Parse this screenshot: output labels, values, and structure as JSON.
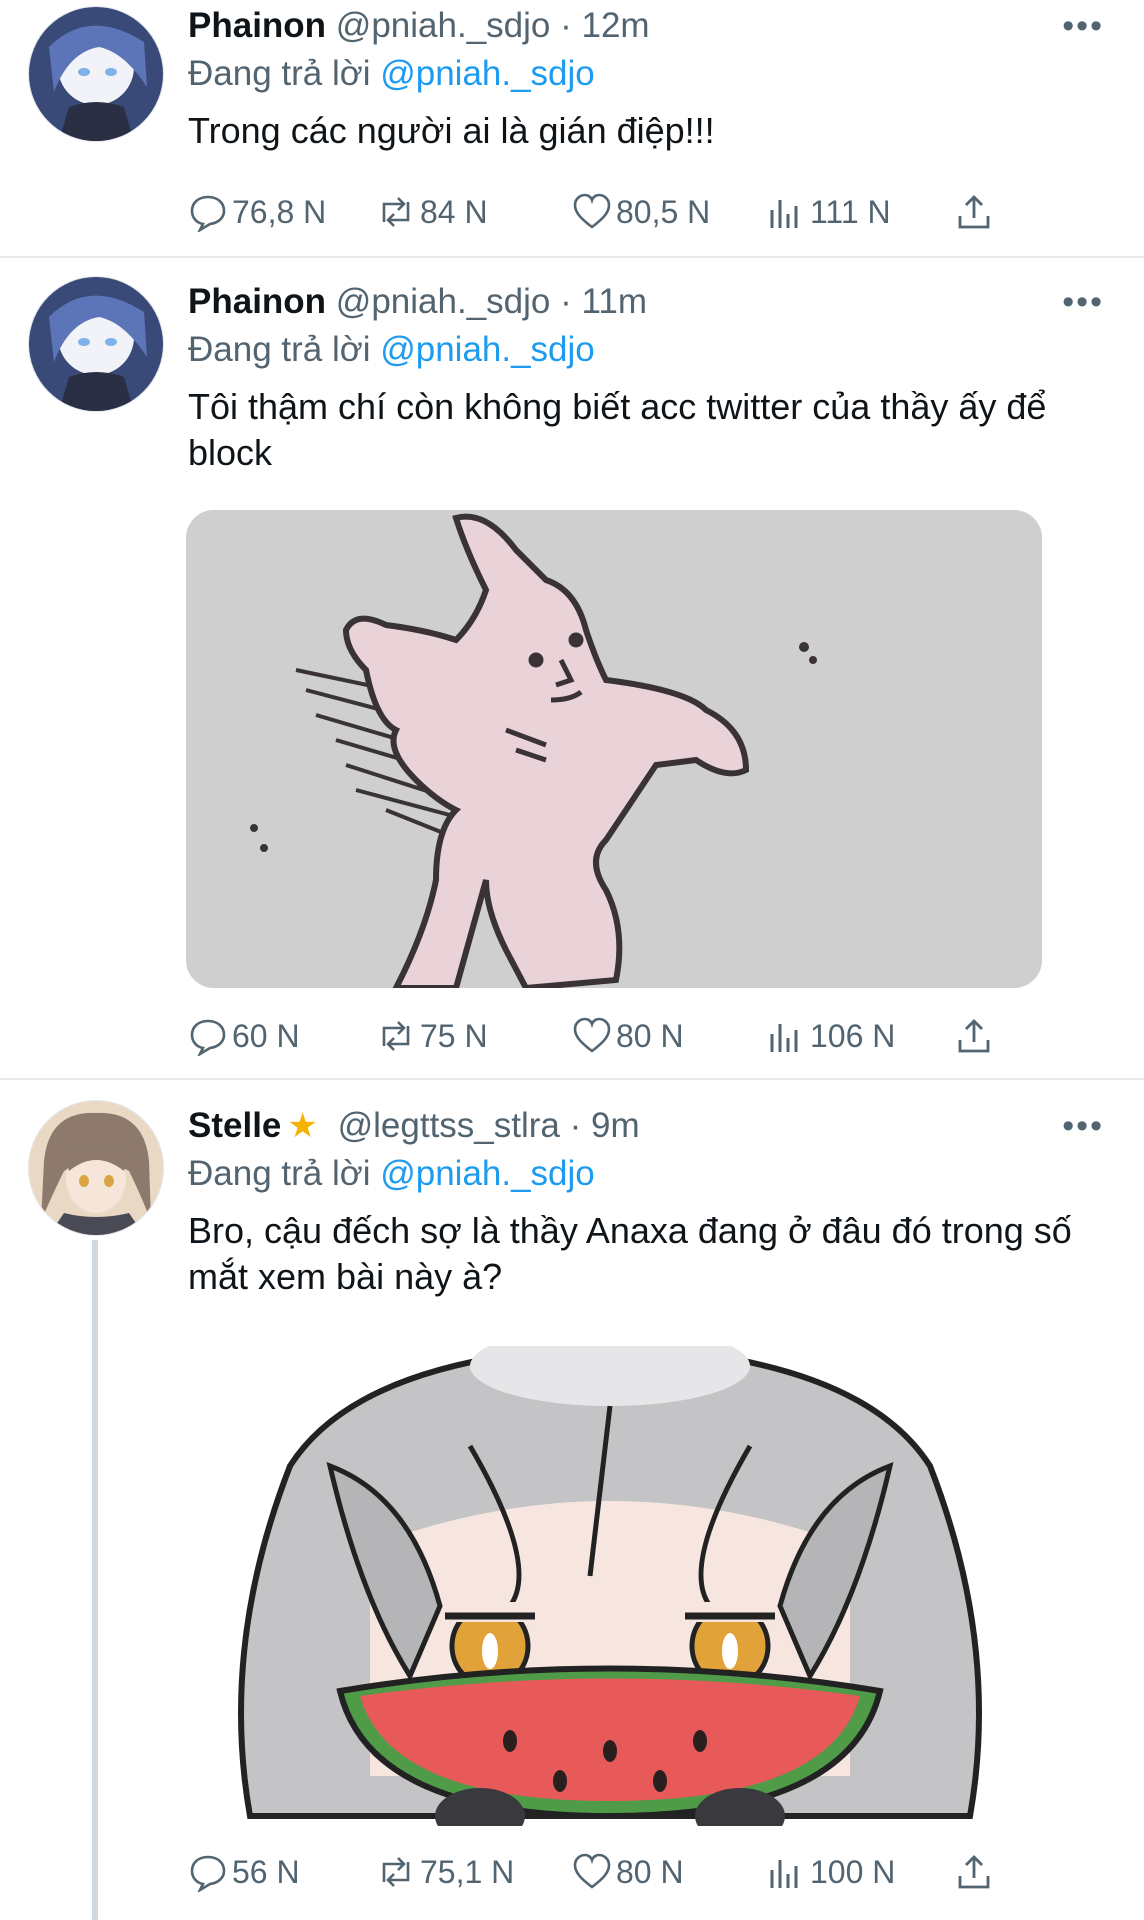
{
  "tweets": [
    {
      "name": "Phainon",
      "handle": "@pniah._sdjo",
      "dot": "·",
      "time": "12m",
      "more_icon": "more-dots-icon",
      "reply_prefix": "Đang trả lời",
      "reply_mention": "@pniah._sdjo",
      "text": "Trong các người ai là gián điệp!!!",
      "actions": {
        "reply": "76,8 N",
        "retweet": "84 N",
        "like": "80,5 N",
        "views": "111 N"
      }
    },
    {
      "name": "Phainon",
      "handle": "@pniah._sdjo",
      "dot": "·",
      "time": "11m",
      "reply_prefix": "Đang trả lời",
      "reply_mention": "@pniah._sdjo",
      "text": "Tôi thậm chí còn không biết acc twitter của thầy ấy để block",
      "media": "pink-bunny-meme-drawing",
      "actions": {
        "reply": "60 N",
        "retweet": "75 N",
        "like": "80 N",
        "views": "106 N"
      }
    },
    {
      "name": "Stelle",
      "badge_icon": "star-icon",
      "handle": "@legttss_stlra",
      "dot": "·",
      "time": "9m",
      "reply_prefix": "Đang trả lời",
      "reply_mention": "@pniah._sdjo",
      "text": "Bro, cậu đếch sợ là thầy Anaxa đang ở đâu đó trong số mắt xem bài này à?",
      "media": "chibi-girl-eating-watermelon",
      "actions": {
        "reply": "56 N",
        "retweet": "75,1 N",
        "like": "80 N",
        "views": "100 N"
      }
    }
  ],
  "colors": {
    "mention": "#1d9bf0",
    "secondary": "#536471",
    "text": "#0f1419",
    "divider": "#e6e9ec"
  }
}
